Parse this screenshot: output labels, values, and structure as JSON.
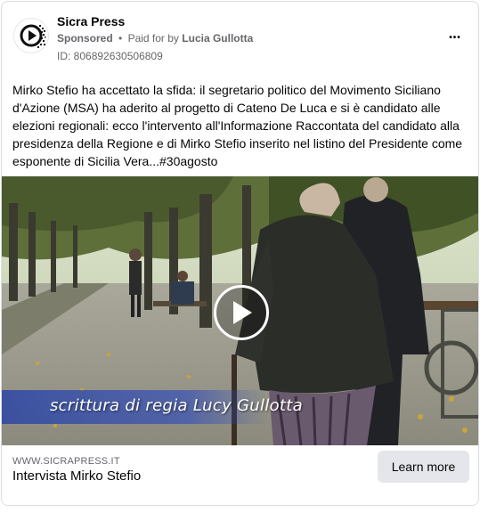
{
  "ad": {
    "page_name": "Sicra Press",
    "sponsored_label": "Sponsored",
    "separator": "•",
    "paid_for_prefix": "Paid for by",
    "paid_for_by": "Lucia Gullotta",
    "ad_id": "ID: 806892630506809",
    "more_icon": "more-horizontal-icon",
    "more_label": "•••"
  },
  "post": {
    "text": "Mirko Stefio ha accettato la sfida: il segretario politico del Movimento Siciliano d'Azione (MSA) ha aderito al progetto di Cateno De Luca e si è candidato alle elezioni regionali: ecco l'intervento all'Informazione Raccontata del candidato alla presidenza della Regione e di Mirko Stefio inserito nel listino del Presidente come esponente di Sicilia Vera...#30agosto"
  },
  "media": {
    "type": "video",
    "play_icon": "play-icon",
    "caption": "scrittura di regia Lucy Gullotta"
  },
  "link": {
    "domain": "WWW.SICRAPRESS.IT",
    "title": "Intervista Mirko Stefio",
    "cta_label": "Learn more"
  },
  "colors": {
    "text_primary": "#050505",
    "text_secondary": "#65676b",
    "button_bg": "#e4e6eb",
    "border": "#dadde1"
  }
}
